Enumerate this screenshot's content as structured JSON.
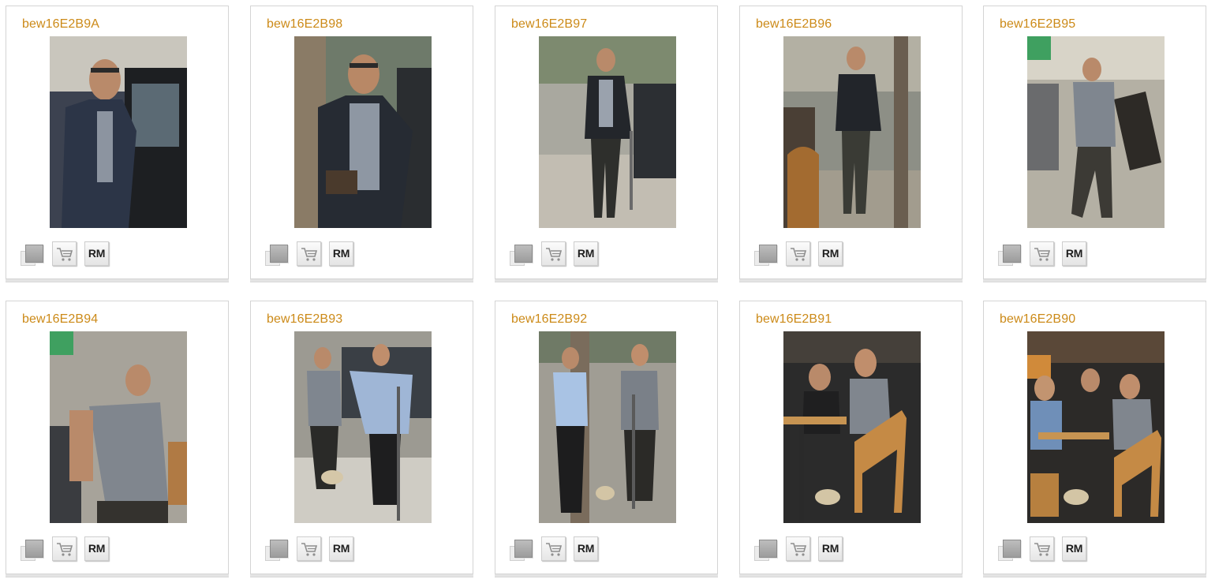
{
  "gallery": {
    "items": [
      {
        "code": "bew16E2B9A",
        "rm_label": "RM",
        "photo_icon": "street-photo-icon"
      },
      {
        "code": "bew16E2B98",
        "rm_label": "RM",
        "photo_icon": "street-photo-icon"
      },
      {
        "code": "bew16E2B97",
        "rm_label": "RM",
        "photo_icon": "street-photo-icon"
      },
      {
        "code": "bew16E2B96",
        "rm_label": "RM",
        "photo_icon": "street-photo-icon"
      },
      {
        "code": "bew16E2B95",
        "rm_label": "RM",
        "photo_icon": "street-photo-icon"
      },
      {
        "code": "bew16E2B94",
        "rm_label": "RM",
        "photo_icon": "street-photo-icon"
      },
      {
        "code": "bew16E2B93",
        "rm_label": "RM",
        "photo_icon": "street-photo-icon"
      },
      {
        "code": "bew16E2B92",
        "rm_label": "RM",
        "photo_icon": "street-photo-icon"
      },
      {
        "code": "bew16E2B91",
        "rm_label": "RM",
        "photo_icon": "cafe-photo-icon"
      },
      {
        "code": "bew16E2B90",
        "rm_label": "RM",
        "photo_icon": "cafe-photo-icon"
      }
    ]
  },
  "icons": {
    "lightbox": "lightbox-icon",
    "cart": "shopping-cart-icon"
  },
  "colors": {
    "code_text": "#cc8a18",
    "card_border": "#d4d4d4"
  }
}
